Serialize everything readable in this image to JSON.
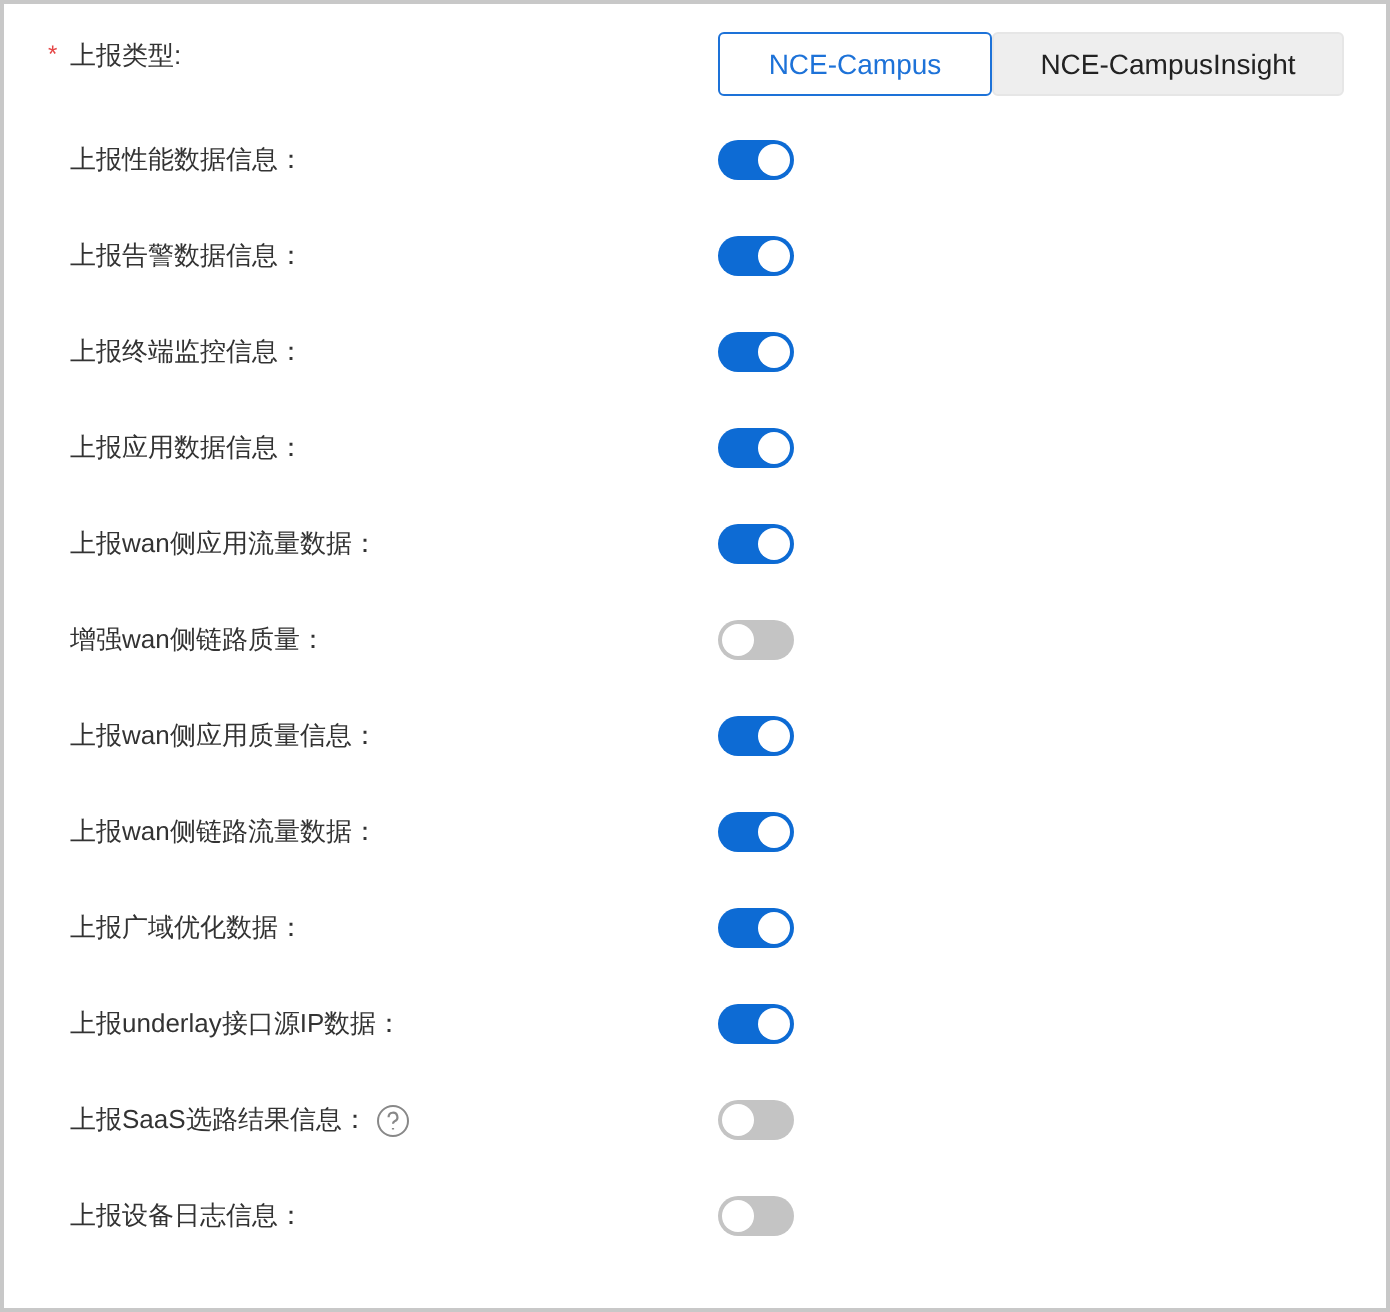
{
  "report_type": {
    "required_mark": "*",
    "label": "上报类型:",
    "options": [
      {
        "label": "NCE-Campus",
        "selected": true
      },
      {
        "label": "NCE-CampusInsight",
        "selected": false
      }
    ]
  },
  "settings": [
    {
      "label": "上报性能数据信息：",
      "on": true,
      "help": false
    },
    {
      "label": "上报告警数据信息：",
      "on": true,
      "help": false
    },
    {
      "label": "上报终端监控信息：",
      "on": true,
      "help": false
    },
    {
      "label": "上报应用数据信息：",
      "on": true,
      "help": false
    },
    {
      "label": "上报wan侧应用流量数据：",
      "on": true,
      "help": false
    },
    {
      "label": "增强wan侧链路质量：",
      "on": false,
      "help": false
    },
    {
      "label": "上报wan侧应用质量信息：",
      "on": true,
      "help": false
    },
    {
      "label": "上报wan侧链路流量数据：",
      "on": true,
      "help": false
    },
    {
      "label": "上报广域优化数据：",
      "on": true,
      "help": false
    },
    {
      "label": "上报underlay接口源IP数据：",
      "on": true,
      "help": false
    },
    {
      "label": "上报SaaS选路结果信息：",
      "on": false,
      "help": true
    },
    {
      "label": "上报设备日志信息：",
      "on": false,
      "help": false
    }
  ]
}
